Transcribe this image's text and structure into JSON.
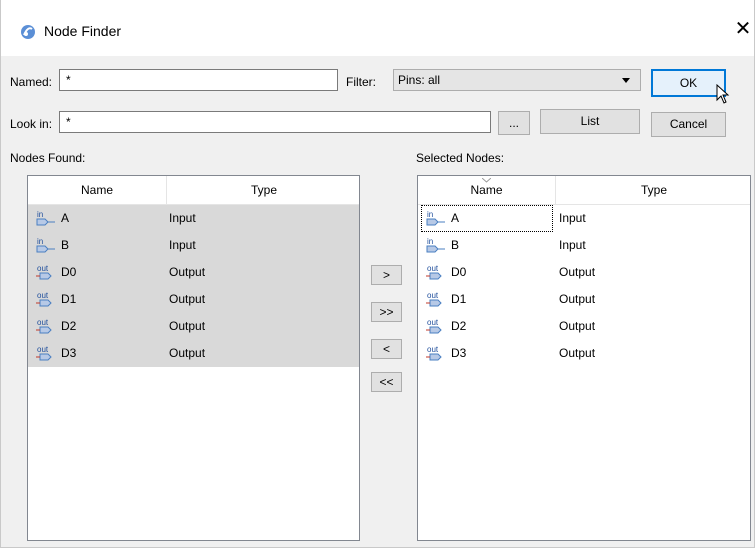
{
  "window": {
    "title": "Node Finder",
    "close_symbol": "✕"
  },
  "form": {
    "named_label": "Named:",
    "named_value": "*",
    "filter_label": "Filter:",
    "filter_value": "Pins: all",
    "lookin_label": "Look in:",
    "lookin_value": "*",
    "browse_label": "...",
    "list_label": "List",
    "ok_label": "OK",
    "cancel_label": "Cancel"
  },
  "nodes_found": {
    "label": "Nodes Found:",
    "columns": [
      "Name",
      "Type"
    ],
    "rows": [
      {
        "dir": "in",
        "name": "A",
        "type": "Input"
      },
      {
        "dir": "in",
        "name": "B",
        "type": "Input"
      },
      {
        "dir": "out",
        "name": "D0",
        "type": "Output"
      },
      {
        "dir": "out",
        "name": "D1",
        "type": "Output"
      },
      {
        "dir": "out",
        "name": "D2",
        "type": "Output"
      },
      {
        "dir": "out",
        "name": "D3",
        "type": "Output"
      }
    ]
  },
  "selected_nodes": {
    "label": "Selected Nodes:",
    "columns": [
      "Name",
      "Type"
    ],
    "rows": [
      {
        "dir": "in",
        "name": "A",
        "type": "Input"
      },
      {
        "dir": "in",
        "name": "B",
        "type": "Input"
      },
      {
        "dir": "out",
        "name": "D0",
        "type": "Output"
      },
      {
        "dir": "out",
        "name": "D1",
        "type": "Output"
      },
      {
        "dir": "out",
        "name": "D2",
        "type": "Output"
      },
      {
        "dir": "out",
        "name": "D3",
        "type": "Output"
      }
    ]
  },
  "move_buttons": {
    "add": ">",
    "add_all": ">>",
    "remove": "<",
    "remove_all": "<<"
  },
  "pin_labels": {
    "in": "in",
    "out": "out"
  },
  "colors": {
    "accent": "#0078d7",
    "pin_in": "#4a7fc1",
    "pin_out": "#c0392b"
  }
}
